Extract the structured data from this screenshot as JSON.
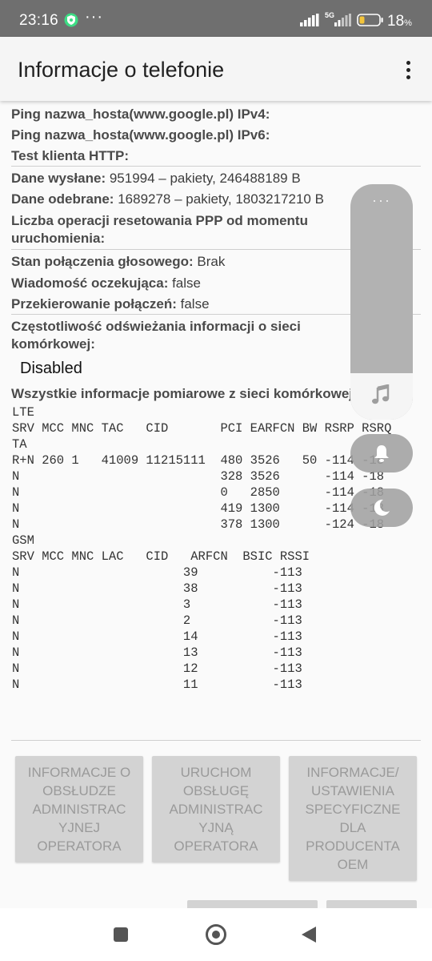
{
  "status_bar": {
    "time": "23:16",
    "more": "···",
    "network": "5G",
    "battery_pct": "18",
    "battery_unit": "%"
  },
  "app_bar": {
    "title": "Informacje o telefonie"
  },
  "info": {
    "ping_ipv4_label": "Ping nazwa_hosta(www.google.pl) IPv4:",
    "ping_ipv6_label": "Ping nazwa_hosta(www.google.pl) IPv6:",
    "http_test_label": "Test klienta HTTP:",
    "data_sent_label": "Dane wysłane:",
    "data_sent_value": " 951994 – pakiety, 246488189 B",
    "data_received_label": "Dane odebrane:",
    "data_received_value": " 1689278 – pakiety, 1803217210 B",
    "ppp_reset_label": "Liczba operacji resetowania PPP od momentu uruchomienia:",
    "voice_state_label": "Stan połączenia głosowego:",
    "voice_state_value": " Brak",
    "message_waiting_label": "Wiadomość oczekująca:",
    "message_waiting_value": " false",
    "call_forwarding_label": "Przekierowanie połączeń:",
    "call_forwarding_value": " false",
    "refresh_rate_label": "Częstotliwość odświeżania informacji o sieci komórkowej:",
    "refresh_rate_value": "Disabled",
    "all_measurements_label": "Wszystkie informacje pomiarowe z sieci komórkowej:"
  },
  "cell_info": {
    "lte_title": "LTE",
    "lte_header": "SRV MCC MNC TAC   CID       PCI EARFCN BW RSRP RSRQ\nTA",
    "lte_rows": [
      "R+N 260 1   41009 11215111  480 3526   50 -114 -18",
      "N                           328 3526      -114 -18",
      "N                           0   2850      -114 -18",
      "N                           419 1300      -114 -18",
      "N                           378 1300      -124 -18"
    ],
    "gsm_title": "GSM",
    "gsm_header": "SRV MCC MNC LAC   CID   ARFCN  BSIC RSSI",
    "gsm_rows": [
      "N                      39          -113",
      "N                      38          -113",
      "N                      3           -113",
      "N                      2           -113",
      "N                      14          -113",
      "N                      13          -113",
      "N                      12          -113",
      "N                      11          -113"
    ]
  },
  "buttons": {
    "carrier_info": "INFORMACJE O OBSŁUDZE ADMINISTRAC YJNEJ OPERATORA",
    "carrier_launch": "URUCHOM OBSŁUGĘ ADMINISTRAC YJNĄ OPERATORA",
    "oem_settings": "INFORMACJE/ USTAWIENIA SPECYFICZNE DLA PRODUCENTA OEM"
  },
  "icons": {
    "notification": "vpn-shield-icon",
    "music": "music-note-icon",
    "bell": "bell-icon",
    "moon": "moon-icon"
  },
  "colors": {
    "status_bar": "#6f6f6f",
    "button_bg": "#d3d3d3",
    "button_text": "#9a9a9a",
    "notif_green": "#3ddc84",
    "battery_yellow": "#f3c43a"
  }
}
